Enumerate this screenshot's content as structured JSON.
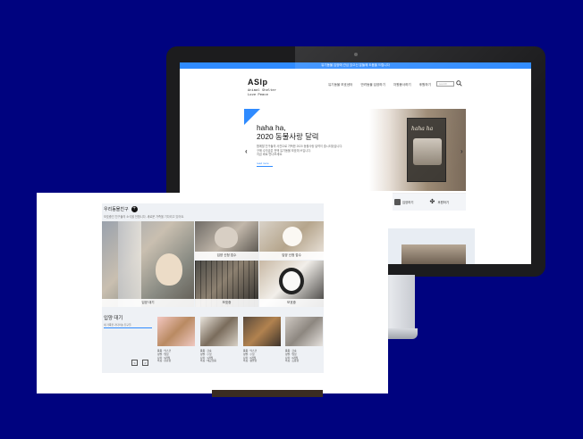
{
  "monitor": {
    "topbar_text": "유기동물 입양에 관심 있으신 분들께 도움을 드립니다",
    "logo": "ASlp",
    "logo_sub": "Animal Shelter\nLove Peace",
    "nav": [
      "유기동물 보호센터",
      "반려동물 입양하기",
      "자원봉사하기",
      "후원하기"
    ],
    "search_placeholder": "search",
    "hero": {
      "title": "haha ha,\n2020 동물사랑 달력",
      "desc": "함께할 친구들의 사진으로 가득한 2020 동물사랑 달력이 출시되었습니다.\n구매 수익금은 전액 유기동물 보호에 쓰입니다.\n지금 바로 만나보세요.",
      "more": "read more",
      "calendar_title": "haha ha"
    },
    "quick_links": [
      "입양하기",
      "후원하기"
    ]
  },
  "page": {
    "section_title": "우리동물친구",
    "section_desc": "보호중인 친구들의 소식을 전합니다. 새로운 가족을 기다리고 있어요.",
    "tiles": [
      {
        "caption": "입양 대기"
      },
      {
        "caption": "입양 신청 접수"
      },
      {
        "caption": "입양 신청 접수"
      },
      {
        "caption": "보호중"
      },
      {
        "caption": "보호중"
      }
    ],
    "adopt": {
      "title": "입양 대기",
      "sub": "새 가족을 기다리는 친구들",
      "prev": "<",
      "next": ">"
    },
    "cards": [
      {
        "info": "품종 : 믹스견\n성별 : 암컷\n나이 : 3개월\n특징 : 온순함"
      },
      {
        "info": "품종 : 코숏\n성별 : 수컷\n나이 : 1개월\n특징 : 애교많음"
      },
      {
        "info": "품종 : 믹스견\n성별 : 수컷\n나이 : 2개월\n특징 : 활발함"
      },
      {
        "info": "품종 : 코숏\n성별 : 암컷\n나이 : 2개월\n특징 : 조용함"
      }
    ]
  },
  "colors": {
    "background": "#00037f",
    "accent": "#2f8bff"
  }
}
